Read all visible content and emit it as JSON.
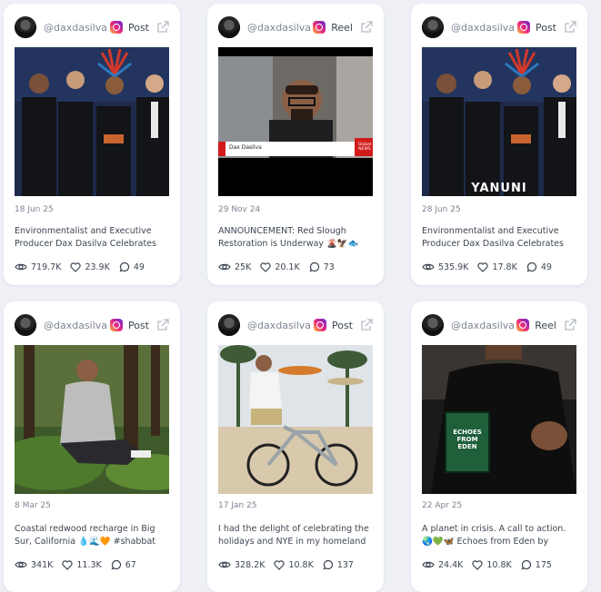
{
  "cards": [
    {
      "handle": "@daxdasilva",
      "type": "Post",
      "date": "18 Jun 25",
      "caption": "Environmentalist and Executive Producer Dax Dasilva Celebrates Worl...",
      "views": "719.7K",
      "likes": "23.9K",
      "comments": "49"
    },
    {
      "handle": "@daxdasilva",
      "type": "Reel",
      "date": "29 Nov 24",
      "caption": "ANNOUNCEMENT: Red Slough Restoration is Underway 🌋🦅🐟🌲...",
      "views": "25K",
      "likes": "20.1K",
      "comments": "73",
      "overlay_name": "Dax Dasilva",
      "overlay_brand": "Global NEWS"
    },
    {
      "handle": "@daxdasilva",
      "type": "Post",
      "date": "28 Jun 25",
      "caption": "Environmentalist and Executive Producer Dax Dasilva Celebrates Worl...",
      "views": "535.9K",
      "likes": "17.8K",
      "comments": "49",
      "overlay_title": "YANUNI"
    },
    {
      "handle": "@daxdasilva",
      "type": "Post",
      "date": "8 Mar 25",
      "caption": "Coastal redwood recharge in Big Sur, California 💧🌊🧡 #shabbat",
      "views": "341K",
      "likes": "11.3K",
      "comments": "67"
    },
    {
      "handle": "@daxdasilva",
      "type": "Post",
      "date": "17 Jan 25",
      "caption": "I had the delight of celebrating the holidays and NYE in my homeland of...",
      "views": "328.2K",
      "likes": "10.8K",
      "comments": "137"
    },
    {
      "handle": "@daxdasilva",
      "type": "Reel",
      "date": "22 Apr 25",
      "caption": "A planet in crisis. A call to action. 🌏💚🦋 Echoes from Eden by @daxdasilva...",
      "views": "24.4K",
      "likes": "10.8K",
      "comments": "175",
      "overlay_title": "ECHOES FROM EDEN"
    }
  ],
  "colors": {
    "page_bg": "#eef0f6",
    "card_bg": "#ffffff",
    "text": "#3d4652",
    "muted": "#7d8592"
  },
  "icons": [
    "instagram-icon",
    "external-link-icon",
    "eye-icon",
    "heart-icon",
    "comment-icon"
  ]
}
